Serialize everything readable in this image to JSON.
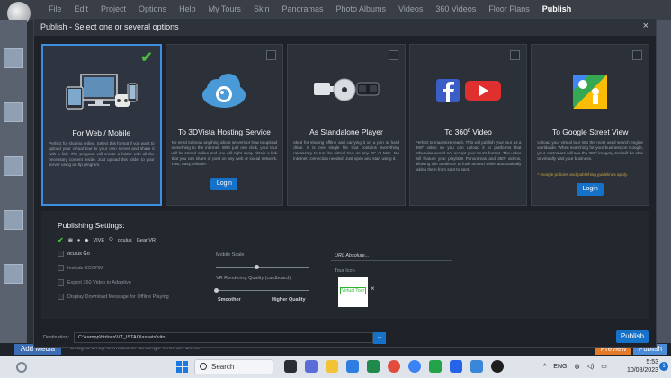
{
  "app": {
    "menu": [
      "File",
      "Edit",
      "Project",
      "Options",
      "Help",
      "My Tours",
      "Skin",
      "Panoramas",
      "Photo Albums",
      "Videos",
      "360 Videos",
      "Floor Plans",
      "Publish"
    ],
    "active_menu": "Publish",
    "add_media_label": "Add Media",
    "bottom_hint": "Drag & Drop a Media or Change it for an Other",
    "preview_label": "Preview",
    "publish_label": "Publish"
  },
  "dialog": {
    "title": "Publish - Select one or several options",
    "close_label": "×",
    "cards": [
      {
        "title": "For Web / Mobile",
        "description": "Perfect for sharing online. Select this format if you want to upload your virtual tour to your own server and share it with a link. The program will create a folder with all the necessary content inside. Just upload this folder to your server using an ftp program.",
        "selected": true,
        "button": ""
      },
      {
        "title": "To 3DVista Hosting Service",
        "description": "No need to know anything about servers or how to upload something to the internet. With just one click, your tour will be stored online and you will right away obtain a link that you can share or post on any web or social network. Fast, easy, reliable.",
        "selected": false,
        "button": "Login"
      },
      {
        "title": "As Standalone Player",
        "description": "Ideal for sharing offline and carrying it on a pen or hard drive. It is one single file that contains everything necessary to run the virtual tour on any PC or Mac. No internet connection needed. Just open and start using it.",
        "selected": false,
        "button": ""
      },
      {
        "title": "To 360º Video",
        "description": "Perfect to maximize reach. This will publish your tour as a 360º video so you can upload it to platforms that otherwise would not accept your tour's format. The video will feature your playlist's Panoramas and 360º videos, allowing the audience to look around while automatically taking them from spot to spot.",
        "selected": false,
        "button": ""
      },
      {
        "title": "To Google Street View",
        "description": "Upload your virtual tour into the most used search engine worldwide. When searching for your business on Google, your customers will see the 360º imagery and will be able to virtually visit your business.",
        "extra": "* Google policies and publishing guidelines apply.",
        "selected": false,
        "button": "Login"
      }
    ],
    "settings": {
      "title": "Publishing Settings:",
      "platforms": [
        "VIVE",
        "oculus",
        "Gear VR"
      ],
      "oculus_go": "oculus Go",
      "include_scorm": "Include SCORM",
      "export_360": "Export 360 Video to Adaptive",
      "display_download": "Display Download Message for Offline Playing",
      "mobile_scale": "Mobile Scale",
      "vr_quality": "VR Rendering Quality (cardboard)",
      "smoother": "Smoother",
      "higher_quality": "Higher Quality",
      "url_value": "URL Absolute...",
      "tour_icon_label": "Tour Icon",
      "tour_icon_text": "Virtual Tour"
    },
    "destination_label": "Destination:",
    "destination_value": "C:\\xampp\\htdocs\\VT_ISTAQ\\assets\\vito",
    "browse_label": "...",
    "publish_label": "Publish"
  },
  "taskbar": {
    "search_placeholder": "Search",
    "lang": "ENG",
    "time": "5:53",
    "date": "10/08/2023",
    "notif_count": "1"
  }
}
